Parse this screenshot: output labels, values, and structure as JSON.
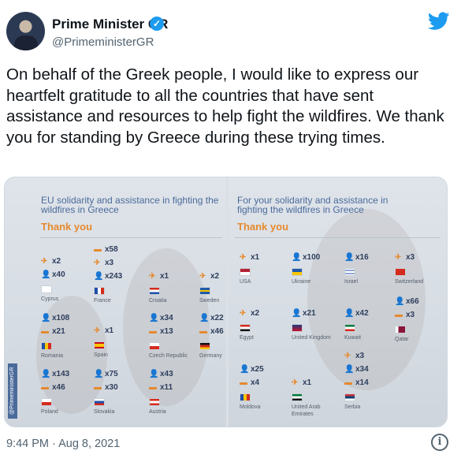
{
  "author": {
    "name": "Prime Minister GR",
    "handle": "@PrimeministerGR",
    "verified_icon": "✓"
  },
  "tweet_text": "On behalf of the Greek people, I would like to express our heartfelt gratitude to all the countries that have sent assistance and resources to help fight the wildfires. We thank you for standing by Greece during these trying times.",
  "media": {
    "left": {
      "title": "EU solidarity and assistance in fighting the wildfires in Greece",
      "thanks": "Thank you",
      "side_tag": "@PrimeministerGR",
      "countries": [
        {
          "name": "Cyprus",
          "assets": [
            {
              "icon": "plane",
              "count": "x2"
            },
            {
              "icon": "person",
              "count": "x40"
            }
          ]
        },
        {
          "name": "France",
          "assets": [
            {
              "icon": "truck",
              "count": "x58"
            },
            {
              "icon": "plane",
              "count": "x3"
            },
            {
              "icon": "person",
              "count": "x243"
            }
          ]
        },
        {
          "name": "Croatia",
          "assets": [
            {
              "icon": "plane",
              "count": "x1"
            }
          ]
        },
        {
          "name": "Sweden",
          "assets": [
            {
              "icon": "plane",
              "count": "x2"
            }
          ]
        },
        {
          "name": "Romania",
          "assets": [
            {
              "icon": "person",
              "count": "x108"
            },
            {
              "icon": "truck",
              "count": "x21"
            }
          ]
        },
        {
          "name": "Spain",
          "assets": [
            {
              "icon": "plane",
              "count": "x1"
            }
          ]
        },
        {
          "name": "Czech Republic",
          "assets": [
            {
              "icon": "person",
              "count": "x34"
            },
            {
              "icon": "truck",
              "count": "x13"
            }
          ]
        },
        {
          "name": "Germany",
          "assets": [
            {
              "icon": "person",
              "count": "x22"
            },
            {
              "icon": "truck",
              "count": "x46"
            }
          ]
        },
        {
          "name": "Poland",
          "assets": [
            {
              "icon": "person",
              "count": "x143"
            },
            {
              "icon": "truck",
              "count": "x46"
            }
          ]
        },
        {
          "name": "Slovakia",
          "assets": [
            {
              "icon": "person",
              "count": "x75"
            },
            {
              "icon": "truck",
              "count": "x30"
            }
          ]
        },
        {
          "name": "Austria",
          "assets": [
            {
              "icon": "person",
              "count": "x43"
            },
            {
              "icon": "truck",
              "count": "x11"
            }
          ]
        }
      ]
    },
    "right": {
      "title": "For your solidarity and assistance in fighting the wildfires in Greece",
      "thanks": "Thank you",
      "countries": [
        {
          "name": "USA",
          "assets": [
            {
              "icon": "plane",
              "count": "x1"
            }
          ]
        },
        {
          "name": "Ukraine",
          "assets": [
            {
              "icon": "person",
              "count": "x100"
            }
          ]
        },
        {
          "name": "Israel",
          "assets": [
            {
              "icon": "person",
              "count": "x16"
            }
          ]
        },
        {
          "name": "Switzerland",
          "assets": [
            {
              "icon": "heli",
              "count": "x3"
            }
          ]
        },
        {
          "name": "Egypt",
          "assets": [
            {
              "icon": "heli",
              "count": "x2"
            }
          ]
        },
        {
          "name": "United Kingdom",
          "assets": [
            {
              "icon": "person",
              "count": "x21"
            }
          ]
        },
        {
          "name": "Kuwait",
          "assets": [
            {
              "icon": "person",
              "count": "x42"
            }
          ]
        },
        {
          "name": "Qatar",
          "assets": [
            {
              "icon": "person",
              "count": "x66"
            },
            {
              "icon": "truck",
              "count": "x3"
            }
          ]
        },
        {
          "name": "Moldova",
          "assets": [
            {
              "icon": "person",
              "count": "x25"
            },
            {
              "icon": "truck",
              "count": "x4"
            }
          ]
        },
        {
          "name": "United Arab Emirates",
          "assets": [
            {
              "icon": "plane",
              "count": "x1"
            }
          ]
        },
        {
          "name": "Serbia",
          "assets": [
            {
              "icon": "heli",
              "count": "x3"
            },
            {
              "icon": "person",
              "count": "x34"
            },
            {
              "icon": "truck",
              "count": "x14"
            }
          ]
        }
      ]
    }
  },
  "timestamp": "9:44 PM · Aug 8, 2021",
  "info_icon": "i",
  "colors": {
    "twitter_blue": "#1d9bf0",
    "accent_orange": "#e58a2e",
    "navy_text": "#2d3d5c",
    "title_blue": "#4a6a9a"
  },
  "icons": {
    "plane": "✈",
    "person": "👤",
    "truck": "▬",
    "heli": "✈"
  }
}
